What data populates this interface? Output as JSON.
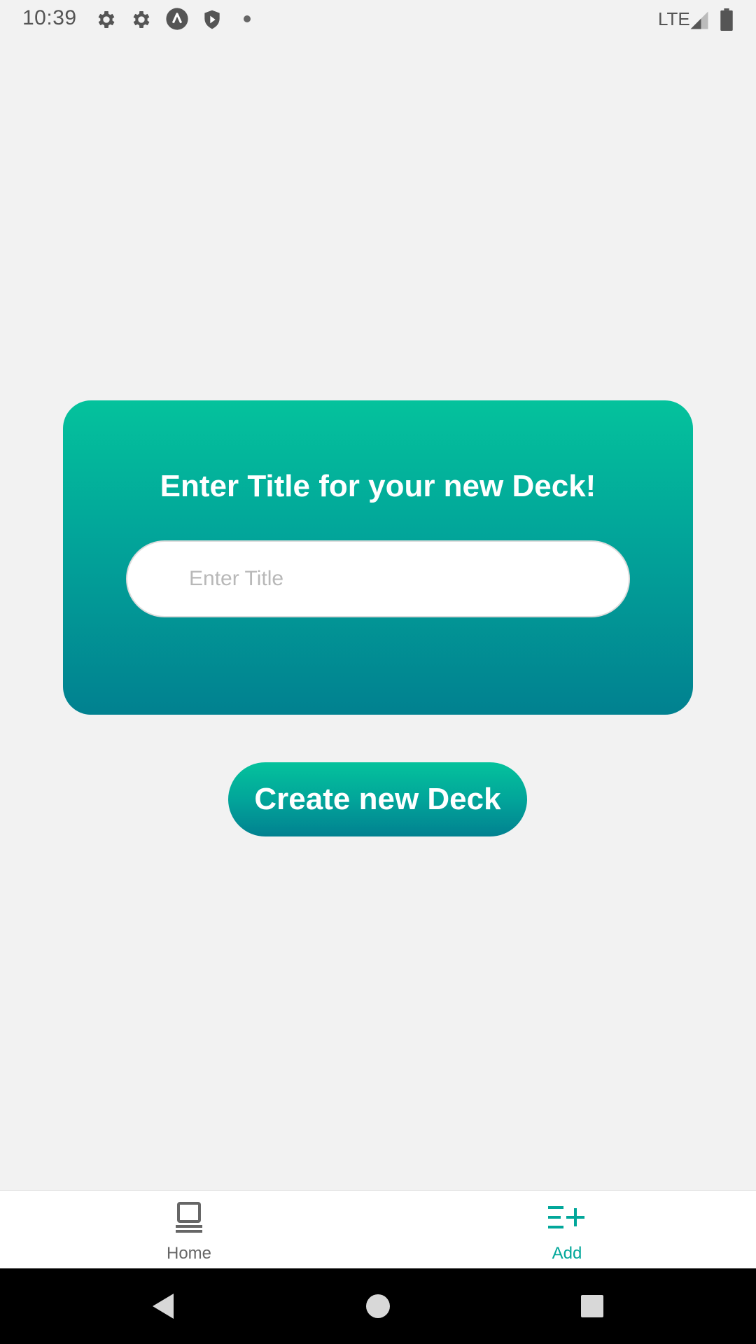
{
  "status_bar": {
    "time": "10:39",
    "icons": [
      "gear-icon",
      "gear-icon",
      "lambda-icon",
      "shield-play-icon",
      "dot-icon"
    ],
    "network": "LTE",
    "signal_icon": "signal-icon",
    "battery_icon": "battery-icon"
  },
  "card": {
    "heading": "Enter Title for your new Deck!",
    "input_placeholder": "Enter Title",
    "input_value": ""
  },
  "create_button": {
    "label": "Create new Deck"
  },
  "bottom_nav": {
    "items": [
      {
        "label": "Home",
        "icon": "deck-stack-icon",
        "active": false
      },
      {
        "label": "Add",
        "icon": "list-add-icon",
        "active": true
      }
    ]
  },
  "system_nav": {
    "buttons": [
      "back-icon",
      "home-circle-icon",
      "recents-square-icon"
    ]
  },
  "colors": {
    "accent": "#02a79a",
    "gradient_top": "#04c29c",
    "gradient_bottom": "#018190",
    "background": "#f2f2f2",
    "inactive": "#666666"
  }
}
